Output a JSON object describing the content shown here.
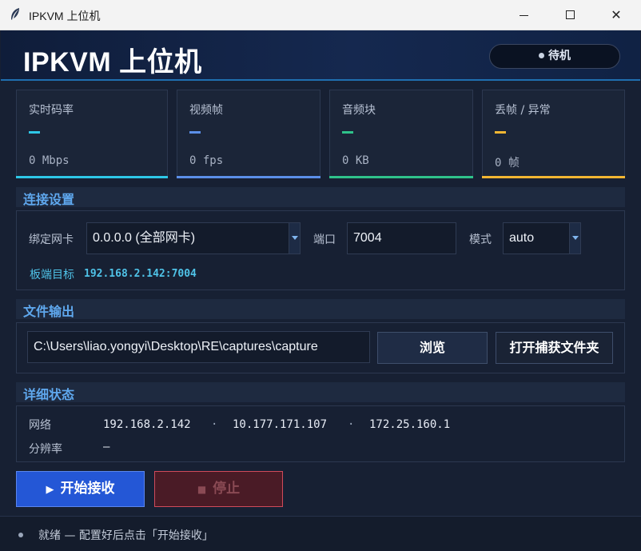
{
  "window": {
    "title": "IPKVM 上位机",
    "minimize_label": "",
    "close_glyph": "✕"
  },
  "header": {
    "title": "IPKVM 上位机",
    "status": "待机"
  },
  "stats": [
    {
      "label": "实时码率",
      "dash": "—",
      "value": "0 Mbps",
      "color": "#2ec7e6"
    },
    {
      "label": "视频帧",
      "dash": "—",
      "value": "0 fps",
      "color": "#5b8fe8"
    },
    {
      "label": "音频块",
      "dash": "—",
      "value": "0 KB",
      "color": "#2fc28a"
    },
    {
      "label": "丢帧 / 异常",
      "dash": "—",
      "value": "0 帧",
      "color": "#f2b632"
    }
  ],
  "connection": {
    "heading": "连接设置",
    "nic_label": "绑定网卡",
    "nic_value": "0.0.0.0  (全部网卡)",
    "port_label": "端口",
    "port_value": "7004",
    "mode_label": "模式",
    "mode_value": "auto",
    "target_label": "板端目标",
    "target_value": "192.168.2.142:7004"
  },
  "output": {
    "heading": "文件输出",
    "path": "C:\\Users\\liao.yongyi\\Desktop\\RE\\captures\\capture",
    "browse_label": "浏览",
    "open_folder_label": "打开捕获文件夹"
  },
  "details": {
    "heading": "详细状态",
    "network_label": "网络",
    "network_ips": [
      "192.168.2.142",
      "10.177.171.107",
      "172.25.160.1"
    ],
    "separator": "·",
    "resolution_label": "分辨率",
    "resolution_value": "—"
  },
  "actions": {
    "start_label": "开始接收",
    "start_icon": "▶",
    "stop_label": "停止",
    "stop_icon": "■"
  },
  "footer": {
    "message": "就绪 — 配置好后点击「开始接收」"
  }
}
